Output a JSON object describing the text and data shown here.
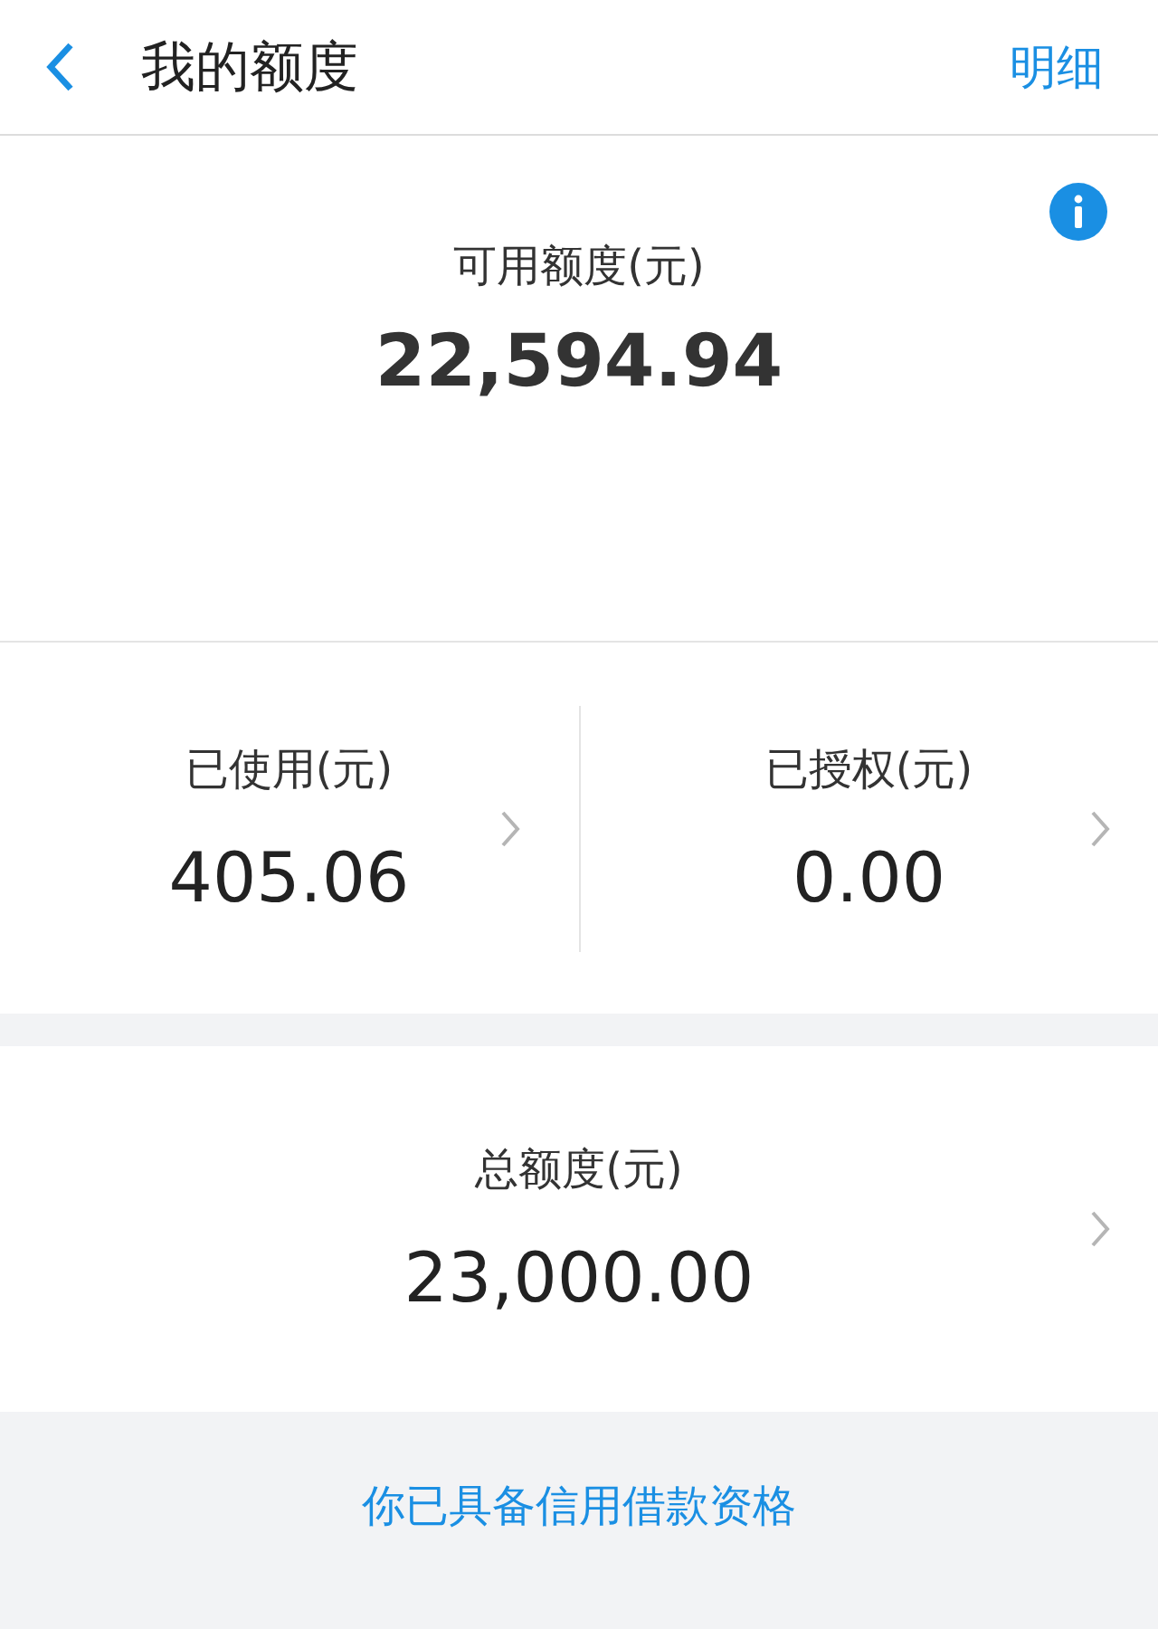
{
  "header": {
    "title": "我的额度",
    "action": "明细"
  },
  "available": {
    "label": "可用额度(元)",
    "amount": "22,594.94"
  },
  "stats": [
    {
      "label": "已使用(元)",
      "amount": "405.06"
    },
    {
      "label": "已授权(元)",
      "amount": "0.00"
    }
  ],
  "total": {
    "label": "总额度(元)",
    "amount": "23,000.00"
  },
  "footer_link": "你已具备信用借款资格"
}
